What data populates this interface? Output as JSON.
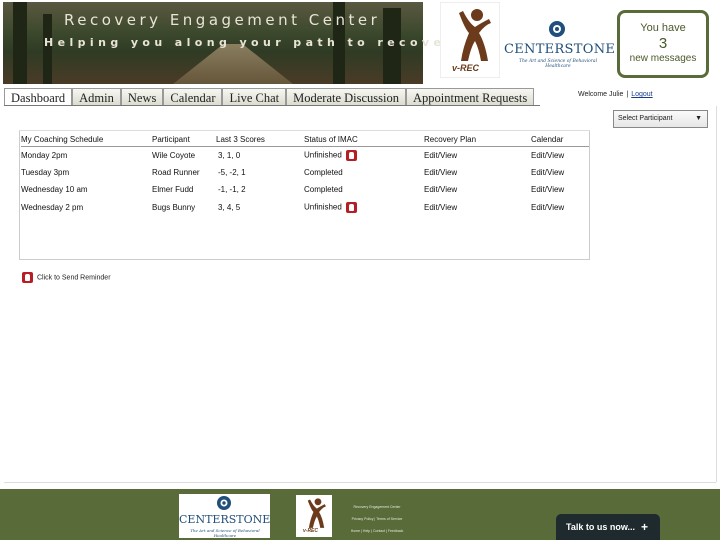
{
  "banner": {
    "title": "Recovery Engagement Center",
    "subtitle": "Helping you along your path to recovery"
  },
  "logos": {
    "vrec": "v-REC",
    "centerstone": "CENTERSTONE",
    "centerstone_tagline": "The Art and Science of Behavioral Healthcare"
  },
  "messages": {
    "line1": "You have",
    "count": "3",
    "line2": "new messages"
  },
  "tabs": [
    {
      "label": "Dashboard",
      "active": true
    },
    {
      "label": "Admin"
    },
    {
      "label": "News"
    },
    {
      "label": "Calendar"
    },
    {
      "label": "Live Chat"
    },
    {
      "label": "Moderate Discussion"
    },
    {
      "label": "Appointment Requests"
    }
  ],
  "user": {
    "welcome": "Welcome Julie",
    "separator": "|",
    "logout": "Logout"
  },
  "participant_select": {
    "selected": "Select Participant",
    "arrow": "▼"
  },
  "schedule": {
    "headers": [
      "My Coaching Schedule",
      "Participant",
      "Last 3 Scores",
      "Status of IMAC",
      "Recovery Plan",
      "Calendar"
    ],
    "rows": [
      {
        "time": "Monday 2pm",
        "participant": "Wile Coyote",
        "scores": "3, 1, 0",
        "status": "Unfinished",
        "reminder": true,
        "plan": "Edit/View",
        "calendar": "Edit/View"
      },
      {
        "time": "Tuesday 3pm",
        "participant": "Road Runner",
        "scores": "-5, -2, 1",
        "status": "Completed",
        "reminder": false,
        "plan": "Edit/View",
        "calendar": "Edit/View"
      },
      {
        "time": "Wednesday 10 am",
        "participant": "Elmer Fudd",
        "scores": "-1, -1, 2",
        "status": "Completed",
        "reminder": false,
        "plan": "Edit/View",
        "calendar": "Edit/View"
      },
      {
        "time": "Wednesday 2 pm",
        "participant": "Bugs Bunny",
        "scores": "3, 4, 5",
        "status": "Unfinished",
        "reminder": true,
        "plan": "Edit/View",
        "calendar": "Edit/View"
      }
    ]
  },
  "reminder_hint": "Click to Send Reminder",
  "footer": {
    "site_name": "Recovery Engagement Center",
    "links_1": "Privacy Policy | Terms of Service",
    "links_2": "Home | Help | Contact | Feedback",
    "centerstone": "CENTERSTONE",
    "centerstone_tagline": "The Art and Science of Behavioral Healthcare",
    "vrec": "v-REC"
  },
  "chat": {
    "label": "Talk to us now...",
    "plus": "+"
  },
  "colors": {
    "accent": "#5a6b3a",
    "reminder_icon": "#b51e24",
    "brand_blue": "#1f4f7a"
  }
}
